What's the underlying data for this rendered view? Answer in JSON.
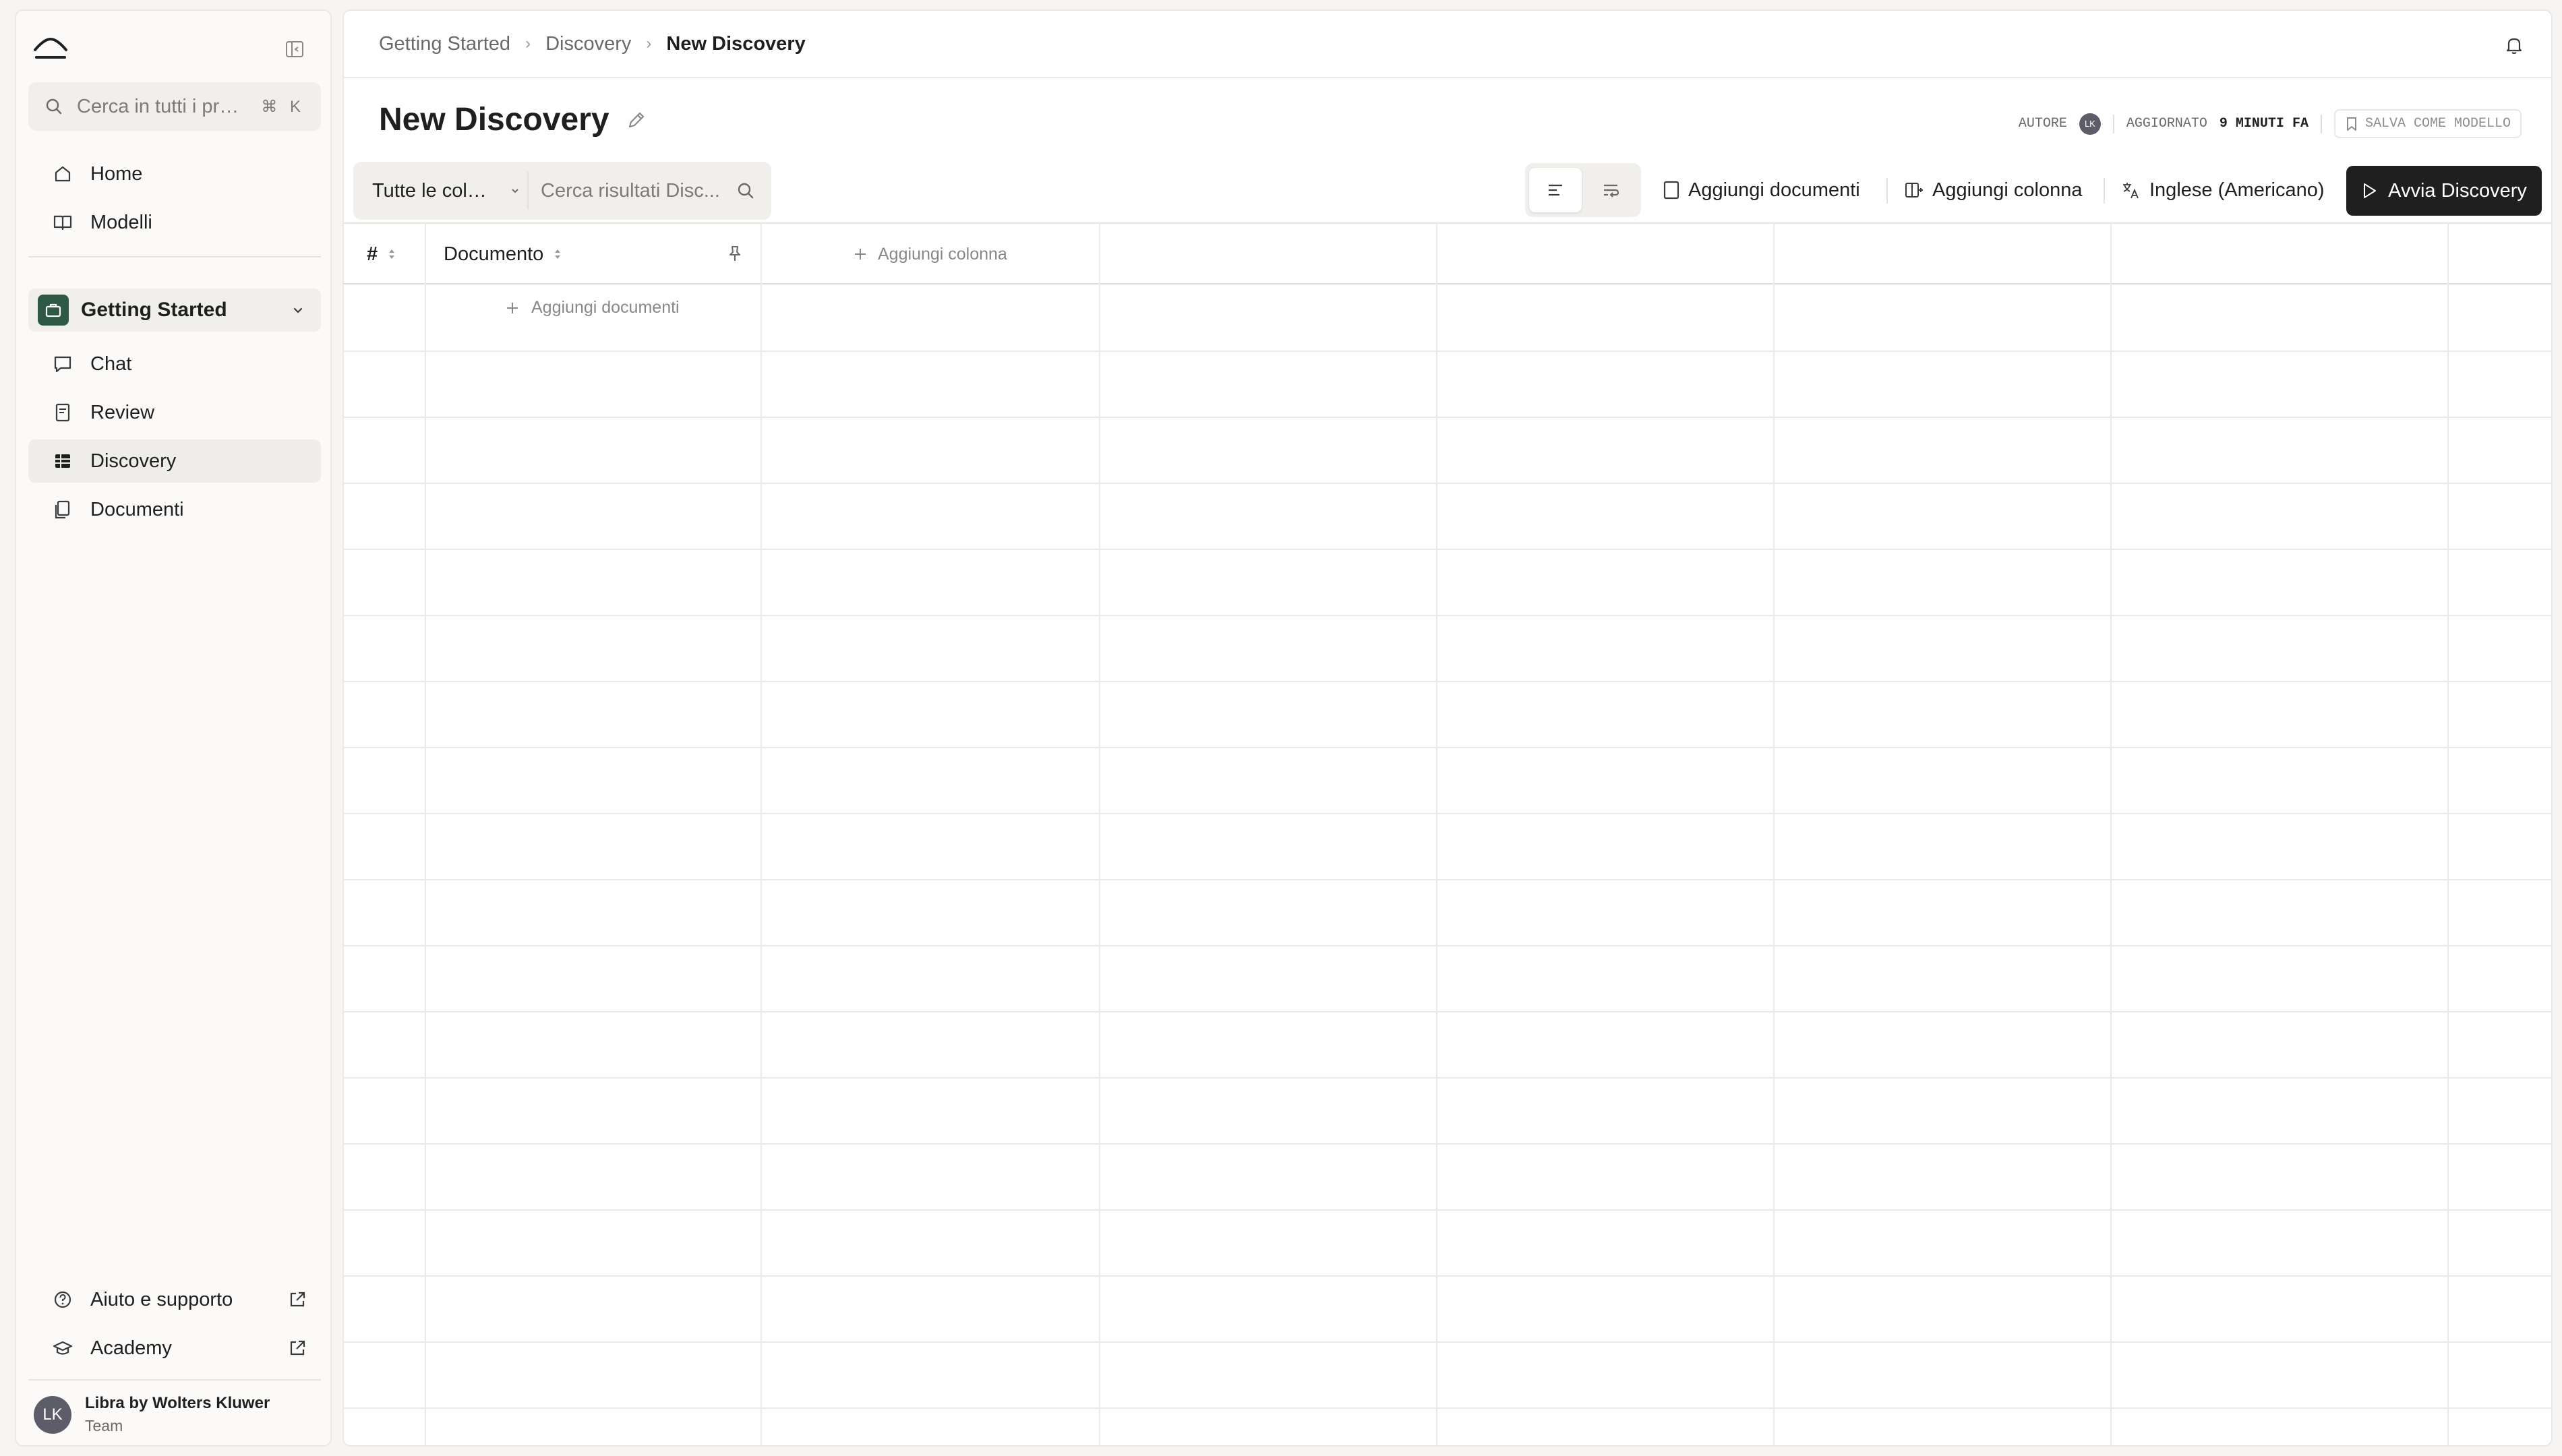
{
  "sidebar": {
    "search_placeholder": "Cerca in tutti i prog...",
    "search_shortcut": "⌘ K",
    "nav": [
      {
        "label": "Home",
        "icon": "home-icon"
      },
      {
        "label": "Modelli",
        "icon": "book-icon"
      }
    ],
    "project": {
      "label": "Getting Started",
      "icon": "briefcase-icon"
    },
    "project_nav": [
      {
        "label": "Chat",
        "icon": "chat-icon"
      },
      {
        "label": "Review",
        "icon": "review-icon"
      },
      {
        "label": "Discovery",
        "icon": "table-icon",
        "active": true
      },
      {
        "label": "Documenti",
        "icon": "documents-icon"
      }
    ],
    "footer_links": [
      {
        "label": "Aiuto e supporto",
        "icon": "help-icon"
      },
      {
        "label": "Academy",
        "icon": "graduation-cap-icon"
      }
    ],
    "user": {
      "initials": "LK",
      "name": "Libra by Wolters Kluwer",
      "plan": "Team"
    }
  },
  "breadcrumb": [
    "Getting Started",
    "Discovery",
    "New Discovery"
  ],
  "page": {
    "title": "New Discovery",
    "author_label": "AUTORE",
    "author_initials": "LK",
    "updated_label": "AGGIORNATO",
    "updated_value": "9 MINUTI FA",
    "save_template_label": "SALVA COME MODELLO"
  },
  "toolbar": {
    "column_filter": "Tutte le colo...",
    "search_placeholder": "Cerca risultati Disc...",
    "add_documents": "Aggiungi documenti",
    "add_column": "Aggiungi colonna",
    "language": "Inglese (Americano)",
    "run": "Avvia Discovery"
  },
  "table": {
    "columns": [
      "#",
      "Documento"
    ],
    "add_column_label": "Aggiungi colonna",
    "add_documents_label": "Aggiungi documenti"
  },
  "colors": {
    "accent_dark": "#1f1f1f",
    "project_icon_bg": "#2e5a45",
    "avatar_bg": "#5c5d68"
  }
}
